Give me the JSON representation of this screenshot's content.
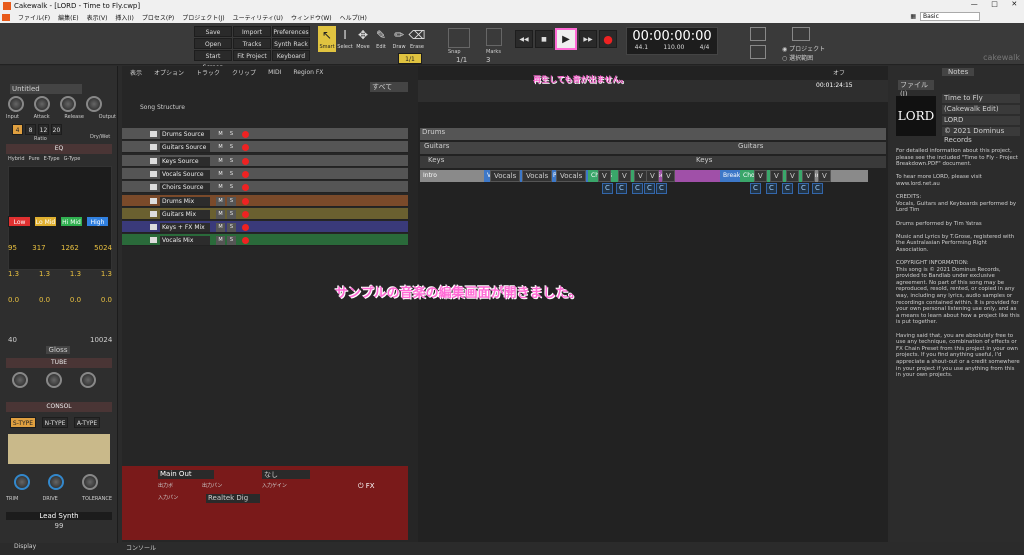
{
  "window": {
    "title": "Cakewalk - [LORD - Time to Fly.cwp]",
    "preset": "Basic"
  },
  "menu": [
    "ファイル(F)",
    "編集(E)",
    "表示(V)",
    "挿入(I)",
    "プロセス(P)",
    "プロジェクト(J)",
    "ユーティリティ(U)",
    "ウィンドウ(W)",
    "ヘルプ(H)"
  ],
  "control_bar": {
    "buttons": [
      [
        "Save",
        "Import",
        "Preferences"
      ],
      [
        "Open",
        "Tracks",
        "Synth Rack"
      ],
      [
        "Start Screen",
        "Fit Project",
        "Keyboard"
      ]
    ],
    "tools": [
      "Smart",
      "Select",
      "Move",
      "Edit",
      "Draw",
      "Erase"
    ],
    "snap_label": "Snap",
    "snap_value": "1/1",
    "fraction": "1/1",
    "marks_label": "Marks",
    "marks_value": "3",
    "time": "00:00:00:00",
    "tempo": "110.00",
    "meter": "4/4",
    "sample_rate": "44.1",
    "bits": "16",
    "radio_project": "プロジェクト",
    "radio_selection": "選択範囲",
    "brand": "cakewalk"
  },
  "inspector": {
    "preset": "Untitled",
    "labels": [
      "Input",
      "Attack",
      "Release",
      "Output"
    ],
    "ratios": [
      "4",
      "8",
      "12",
      "20"
    ],
    "ratio_label": "Ratio",
    "drywet": "Dry/Wet",
    "eq_title": "EQ",
    "eq_modes": [
      "Hybrid",
      "Pure",
      "E-Type",
      "G-Type"
    ],
    "bands": [
      "Low",
      "Lo Mid",
      "Hi Mid",
      "High"
    ],
    "freqs": [
      "95",
      "317",
      "1262",
      "5024"
    ],
    "freq_label": "Frq",
    "q_vals": [
      "1.3",
      "1.3",
      "1.3",
      "1.3"
    ],
    "q_label": "Q",
    "gains": [
      "0.0",
      "0.0",
      "0.0",
      "0.0"
    ],
    "gain_label": "Lvl",
    "hp": "40",
    "lp": "10024",
    "gloss": "Gloss",
    "tube": "TUBE",
    "tube_labels": [
      "Input",
      "Drive",
      "Output"
    ],
    "consol": "CONSOL",
    "types": [
      "S-TYPE",
      "N-TYPE",
      "A-TYPE"
    ],
    "trim": "TRIM",
    "drive": "DRIVE",
    "tol": "TOLERANCE",
    "synth": "Lead Synth",
    "num": "99",
    "display": "Display"
  },
  "track_menu": [
    "表示",
    "オプション",
    "トラック",
    "クリップ",
    "MIDI",
    "Region FX"
  ],
  "all": "すべて",
  "song_structure": "Song Structure",
  "tracks": [
    {
      "name": "Drums Source",
      "color": "#555"
    },
    {
      "name": "Guitars Source",
      "color": "#555"
    },
    {
      "name": "Keys Source",
      "color": "#555"
    },
    {
      "name": "Vocals Source",
      "color": "#555"
    },
    {
      "name": "Choirs Source",
      "color": "#555"
    },
    {
      "name": "Drums Mix",
      "color": "#7a4a2a"
    },
    {
      "name": "Guitars Mix",
      "color": "#6a6030"
    },
    {
      "name": "Keys + FX Mix",
      "color": "#3a3a7a"
    },
    {
      "name": "Vocals Mix",
      "color": "#2a6a3a"
    }
  ],
  "arrangement": [
    {
      "name": "Intro",
      "color": "#8a8a8a"
    },
    {
      "name": "Verse",
      "color": "#3d78c8"
    },
    {
      "name": "Pre-Chorus",
      "color": "#3d78c8"
    },
    {
      "name": "Chorus",
      "color": "#3aa66a"
    },
    {
      "name": "Solo",
      "color": "#a050a8"
    },
    {
      "name": "Break",
      "color": "#3d78c8"
    },
    {
      "name": "Chorus",
      "color": "#3aa66a"
    },
    {
      "name": "Ending",
      "color": "#8a8a8a"
    }
  ],
  "clip_labels": {
    "drums": "Drums",
    "guitars": "Guitars",
    "keys": "Keys",
    "vocals": "Vocals",
    "v": "V",
    "c": "C"
  },
  "ruler_time": "00:01:24:15",
  "off": "オフ",
  "annotations": {
    "top": "再生しても音が出ません。",
    "center": "サンプルの音楽の編集画面が開きました。"
  },
  "bus": {
    "main": "Main Out",
    "none": "なし",
    "out_pan": "出力ボ",
    "out_gain": "出力パン",
    "in_gain": "入力ゲイン",
    "in_pan": "入力パン",
    "device": "Realtek Dig",
    "fx": "FX"
  },
  "console": "コンソール",
  "browser": {
    "tab": "Notes",
    "file": "ファイル(I)",
    "info": [
      "Time to Fly",
      "(Cakewalk Edit)",
      "LORD",
      "© 2021 Dominus Records"
    ],
    "body": "For detailed information about this project, please see the included \"Time to Fly - Project Breakdown.PDF\" document.\n\nTo hear more LORD, please visit www.lord.net.au\n\nCREDITS:\nVocals, Guitars and Keyboards performed by Lord Tim\n\nDrums performed by Tim Yatras\n\nMusic and Lyrics by T.Grose, registered with the Australasian Performing Right Association.\n\nCOPYRIGHT INFORMATION:\nThis song is © 2021 Dominus Records, provided to Bandlab under exclusive agreement. No part of this song may be reproduced, resold, rented, or copied in any way, including any lyrics, audio samples or recordings contained within. It is provided for your own personal listening use only, and as a means to learn about how a project like this is put together.\n\nHaving said that, you are absolutely free to use any technique, combination of effects or FX Chain Preset from this project in your own projects. If you find anything useful, I'd appreciate a shout-out or a credit somewhere in your project if you use anything from this in your own projects."
  },
  "colors": {
    "accent": "#ff6ad5",
    "record": "#e22"
  }
}
